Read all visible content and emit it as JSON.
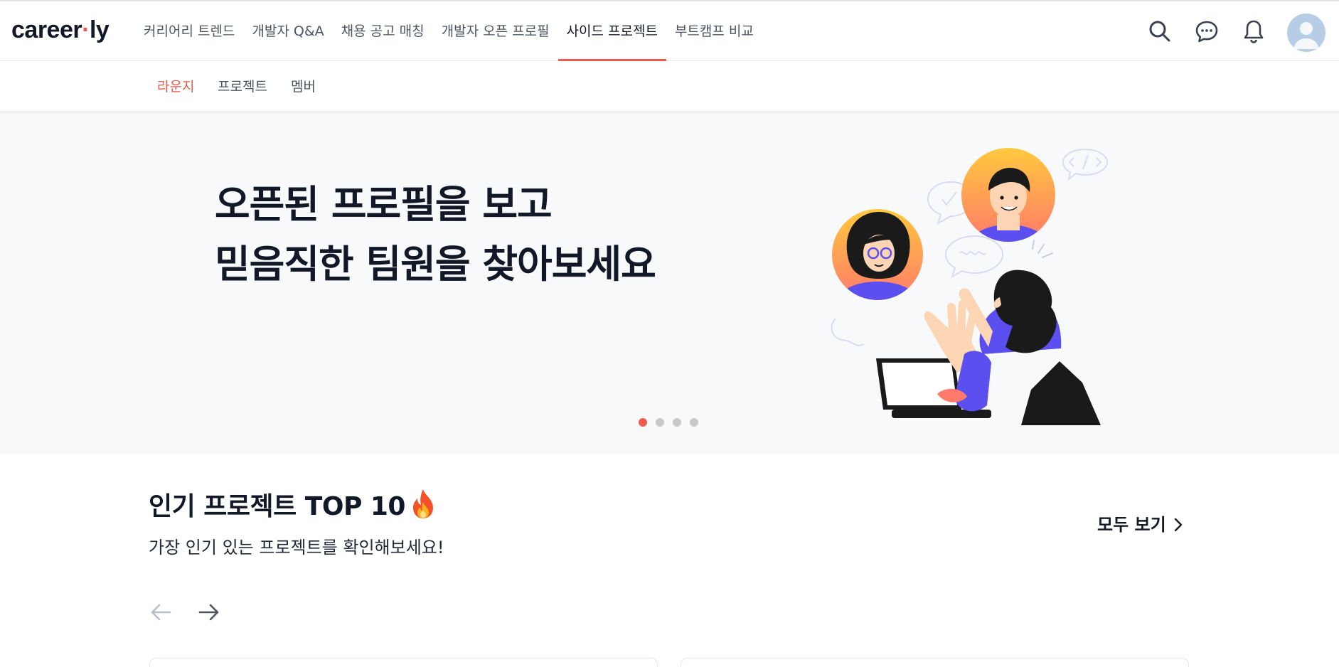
{
  "header": {
    "logo_text_a": "career",
    "logo_dot": "·",
    "logo_text_b": "ly",
    "nav": [
      {
        "label": "커리어리 트렌드"
      },
      {
        "label": "개발자 Q&A"
      },
      {
        "label": "채용 공고 매칭"
      },
      {
        "label": "개발자 오픈 프로필"
      },
      {
        "label": "사이드 프로젝트",
        "active": true
      },
      {
        "label": "부트캠프 비교"
      }
    ],
    "icons": [
      "search-icon",
      "chat-icon",
      "bell-icon",
      "avatar"
    ]
  },
  "subnav": {
    "items": [
      {
        "label": "라운지",
        "active": true
      },
      {
        "label": "프로젝트"
      },
      {
        "label": "멤버"
      }
    ]
  },
  "hero": {
    "line1": "오픈된 프로필을 보고",
    "line2": "믿음직한 팀원을 찾아보세요",
    "slide_count": 4,
    "active_slide": 0
  },
  "section": {
    "title": "인기 프로젝트 TOP 10",
    "title_icon": "fire-icon",
    "subtitle": "가장 인기 있는 프로젝트를 확인해보세요!",
    "view_all": "모두 보기"
  },
  "colors": {
    "accent": "#ef5b4a",
    "text_dark": "#111827",
    "text_muted": "#4b5563",
    "hero_bg": "#f8f9fa",
    "purple": "#5b4ff0"
  }
}
